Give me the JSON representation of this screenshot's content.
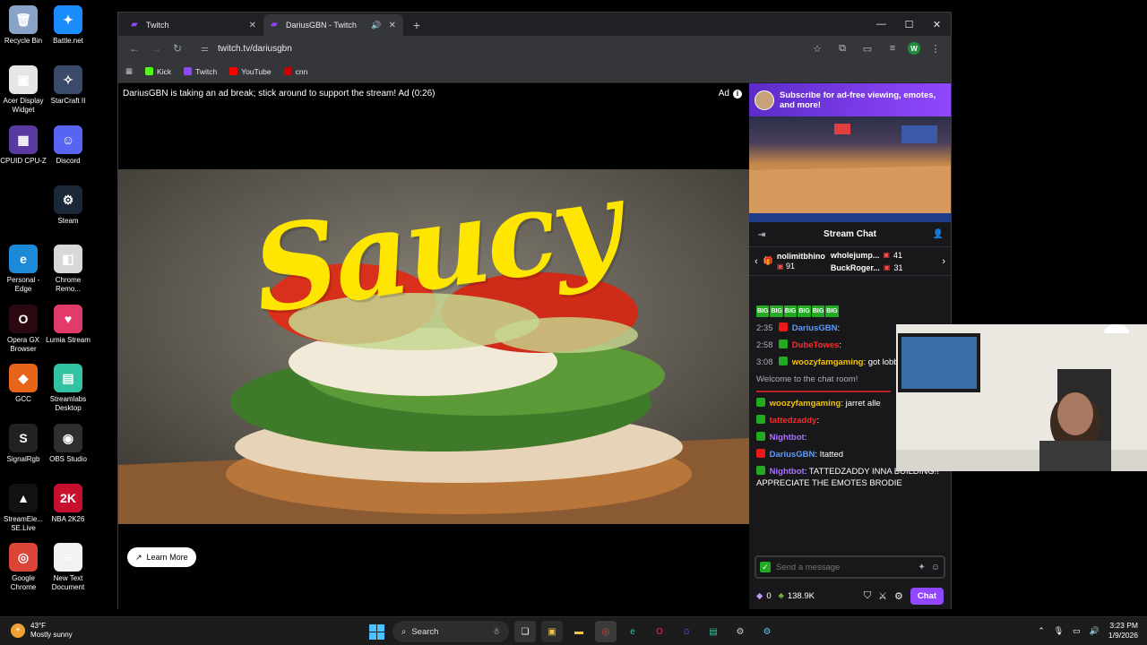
{
  "desktop": {
    "icons": [
      {
        "label": "Recycle Bin",
        "icon": "recycle-bin-icon",
        "color": "#8aa4c8",
        "glyph": "🗑"
      },
      {
        "label": "Battle.net",
        "icon": "battlenet-icon",
        "color": "#1a8cff",
        "glyph": "✦"
      },
      {
        "label": "Acer Display Widget",
        "icon": "acer-display-icon",
        "color": "#e6e6e6",
        "glyph": "▣"
      },
      {
        "label": "StarCraft II",
        "icon": "starcraft-icon",
        "color": "#3a4a6a",
        "glyph": "✧"
      },
      {
        "label": "CPUID CPU-Z",
        "icon": "cpuz-icon",
        "color": "#5a3aa0",
        "glyph": "▦"
      },
      {
        "label": "Discord",
        "icon": "discord-icon",
        "color": "#5865f2",
        "glyph": "☺"
      },
      {
        "label": "Steam",
        "icon": "steam-icon",
        "color": "#1b2838",
        "glyph": "⚙"
      },
      {
        "label": "Personal - Edge",
        "icon": "edge-icon",
        "color": "#1c8ad8",
        "glyph": "e"
      },
      {
        "label": "Chrome Remo...",
        "icon": "chrome-remote-icon",
        "color": "#d8d8d8",
        "glyph": "◧"
      },
      {
        "label": "Opera GX Browser",
        "icon": "opera-gx-icon",
        "color": "#2a0a10",
        "glyph": "O"
      },
      {
        "label": "Lumia Stream",
        "icon": "lumia-icon",
        "color": "#e23a6a",
        "glyph": "♥"
      },
      {
        "label": "GCC",
        "icon": "gcc-icon",
        "color": "#e8641a",
        "glyph": "◆"
      },
      {
        "label": "Streamlabs Desktop",
        "icon": "streamlabs-icon",
        "color": "#31c3a2",
        "glyph": "▤"
      },
      {
        "label": "SignalRgb",
        "icon": "signalrgb-icon",
        "color": "#222",
        "glyph": "S"
      },
      {
        "label": "OBS Studio",
        "icon": "obs-icon",
        "color": "#302e31",
        "glyph": "◉"
      },
      {
        "label": "StreamEle... SE.Live",
        "icon": "streamelements-icon",
        "color": "#111",
        "glyph": "▲"
      },
      {
        "label": "NBA 2K26",
        "icon": "nba2k-icon",
        "color": "#c8102e",
        "glyph": "2K"
      },
      {
        "label": "Google Chrome",
        "icon": "chrome-icon",
        "color": "#db4437",
        "glyph": "◎"
      },
      {
        "label": "New Text Document",
        "icon": "text-doc-icon",
        "color": "#f2f2f2",
        "glyph": "≡"
      }
    ]
  },
  "browser": {
    "tabs": [
      {
        "title": "Twitch",
        "active": false
      },
      {
        "title": "DariusGBN - Twitch",
        "active": true
      }
    ],
    "url": "twitch.tv/dariusgbn",
    "bookmarks": [
      {
        "label": "Kick",
        "color": "#53fc18"
      },
      {
        "label": "Twitch",
        "color": "#9147ff"
      },
      {
        "label": "YouTube",
        "color": "#ff0000"
      },
      {
        "label": "cnn",
        "color": "#cc0000"
      }
    ],
    "profile_initial": "W"
  },
  "player": {
    "ad_message": "DariusGBN is taking an ad break; stick around to support the stream! Ad (0:26)",
    "ad_label": "Ad",
    "ad_title": "Saucy",
    "learn_more": "Learn More"
  },
  "sidebar": {
    "sub_banner": "Subscribe for ad-free viewing, emotes, and more!",
    "chat_title": "Stream Chat",
    "leaderboard": [
      {
        "name": "nolimitbhino",
        "count": "91"
      },
      {
        "name": "wholejump...",
        "count": "41"
      },
      {
        "name": "BuckRoger...",
        "count": "31"
      }
    ],
    "messages": [
      {
        "time": "2:35",
        "user": "DariusGBN",
        "user_class": "user-blue",
        "text": ""
      },
      {
        "time": "2:58",
        "user": "DubeTowes",
        "user_class": "user-red",
        "text": ""
      },
      {
        "time": "3:08",
        "user": "woozyfamgaming",
        "user_class": "user-yellow",
        "text": "got lobby lol"
      }
    ],
    "welcome": "Welcome to the chat room!",
    "live_messages": [
      {
        "user": "woozyfamgaming",
        "user_class": "user-yellow",
        "text": "jarret alle"
      },
      {
        "user": "tattedzaddy",
        "user_class": "user-red",
        "text": ""
      },
      {
        "user": "Nightbot",
        "user_class": "user-purple",
        "text": ""
      },
      {
        "user": "DariusGBN",
        "user_class": "user-blue",
        "text": "Itatted"
      },
      {
        "user": "Nightbot",
        "user_class": "user-purple",
        "text": "TATTEDZADDY INNA BUILDING!! APPRECIATE THE EMOTES BRODIE"
      }
    ],
    "input_placeholder": "Send a message",
    "points": "0",
    "bits": "138.9K",
    "chat_button": "Chat"
  },
  "taskbar": {
    "weather_temp": "43°F",
    "weather_desc": "Mostly sunny",
    "search_label": "Search",
    "time": "3:23 PM",
    "date": "1/9/2026"
  },
  "colors": {
    "twitch_purple": "#9147ff",
    "saucy_yellow": "#ffe600"
  }
}
